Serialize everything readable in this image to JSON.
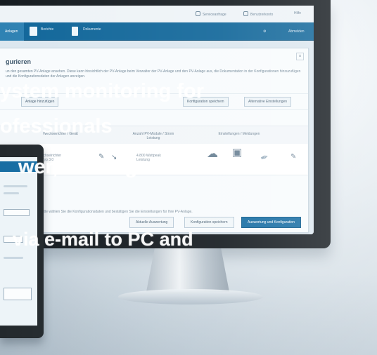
{
  "topbar": {
    "links": [
      "Serviceanfrage",
      "Benutzerkonto",
      "Hilfe"
    ]
  },
  "navigation": {
    "tabs": [
      "Anlagen",
      "Berichte",
      "Dokumente"
    ],
    "right_items": [
      "⚙",
      "Abmelden"
    ]
  },
  "panel": {
    "title": "gurieren",
    "close_label": "×",
    "intro": "un den gesamten PV-Anlage ansehen. Diese kann hinsichtlich der PV-Anlage beim Verwalter der PV-Anlage und den PV-Anlage aus, die Dokumentation in der Konfigurationen hinzuzufügen und die Konfigurationsdaten der Anlagen anzeigen.",
    "options": [
      "Anlage hinzufügen",
      "Konfiguration speichern",
      "Alternative Einstellungen"
    ],
    "table_headers": [
      "Wechselrichter / Gerät",
      "Anzahl PV-Module / Strom\nLeistung",
      "Einstellungen / Meldungen"
    ],
    "device": {
      "name": "PV-Wechselrichter\nGerät Typ 3.0",
      "power": "4.800 Wattpeak\nLeistung"
    },
    "message": "Bitte wählen Sie die Konfigurationsdaten und bestätigen Sie die Einstellungen für Ihre PV-Anlage.",
    "actions": [
      "Aktuelle Auswertung",
      "Konfiguration speichern",
      "Auswertung und Konfiguration"
    ]
  },
  "overlay": {
    "lines": [
      "ystem monitoring for",
      "ofessionals",
      "wer, earnings and",
      "via e-mail to PC and"
    ]
  },
  "icons": {
    "pencil": "✎",
    "arrow": "↘",
    "gear": "⚙",
    "cloud": "☁",
    "shirt": "▣",
    "pen": "✒",
    "edit": "✎"
  }
}
